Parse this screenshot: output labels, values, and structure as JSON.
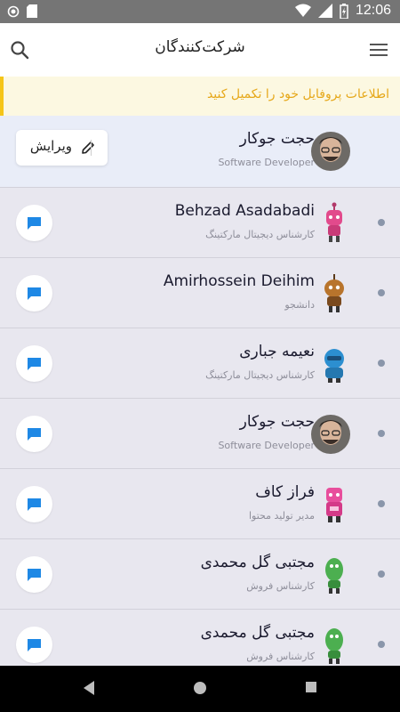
{
  "status_bar": {
    "time": "12:06",
    "icons": [
      "circle-icon",
      "sd-card-icon",
      "wifi-icon",
      "signal-icon",
      "battery-charging-icon"
    ]
  },
  "app_bar": {
    "title": "شرکت‌کنندگان",
    "search_icon": "search-icon",
    "menu_icon": "menu-icon"
  },
  "banner": {
    "text": "اطلاعات پروفایل خود را تکمیل کنید",
    "accent": "#f5c518",
    "text_color": "#e6a81a"
  },
  "me": {
    "name": "حجت جوکار",
    "role": "Software Developer",
    "edit_label": "ویرایش"
  },
  "participants": [
    {
      "name": "Behzad Asadabadi",
      "role": "کارشناس دیجیتال مارکتینگ"
    },
    {
      "name": "Amirhossein Deihim",
      "role": "دانشجو"
    },
    {
      "name": "نعیمه جباری",
      "role": "کارشناس دیجیتال مارکتینگ"
    },
    {
      "name": "حجت جوکار",
      "role": "Software Developer"
    },
    {
      "name": "فراز کاف",
      "role": "مدیر تولید محتوا"
    },
    {
      "name": "مجتبی گل محمدی",
      "role": "کارشناس فروش"
    },
    {
      "name": "مجتبی گل محمدی",
      "role": "کارشناس فروش"
    }
  ],
  "colors": {
    "chat_icon": "#1e88e5",
    "list_background": "#e8e7ef",
    "me_background": "#e9edf8"
  }
}
